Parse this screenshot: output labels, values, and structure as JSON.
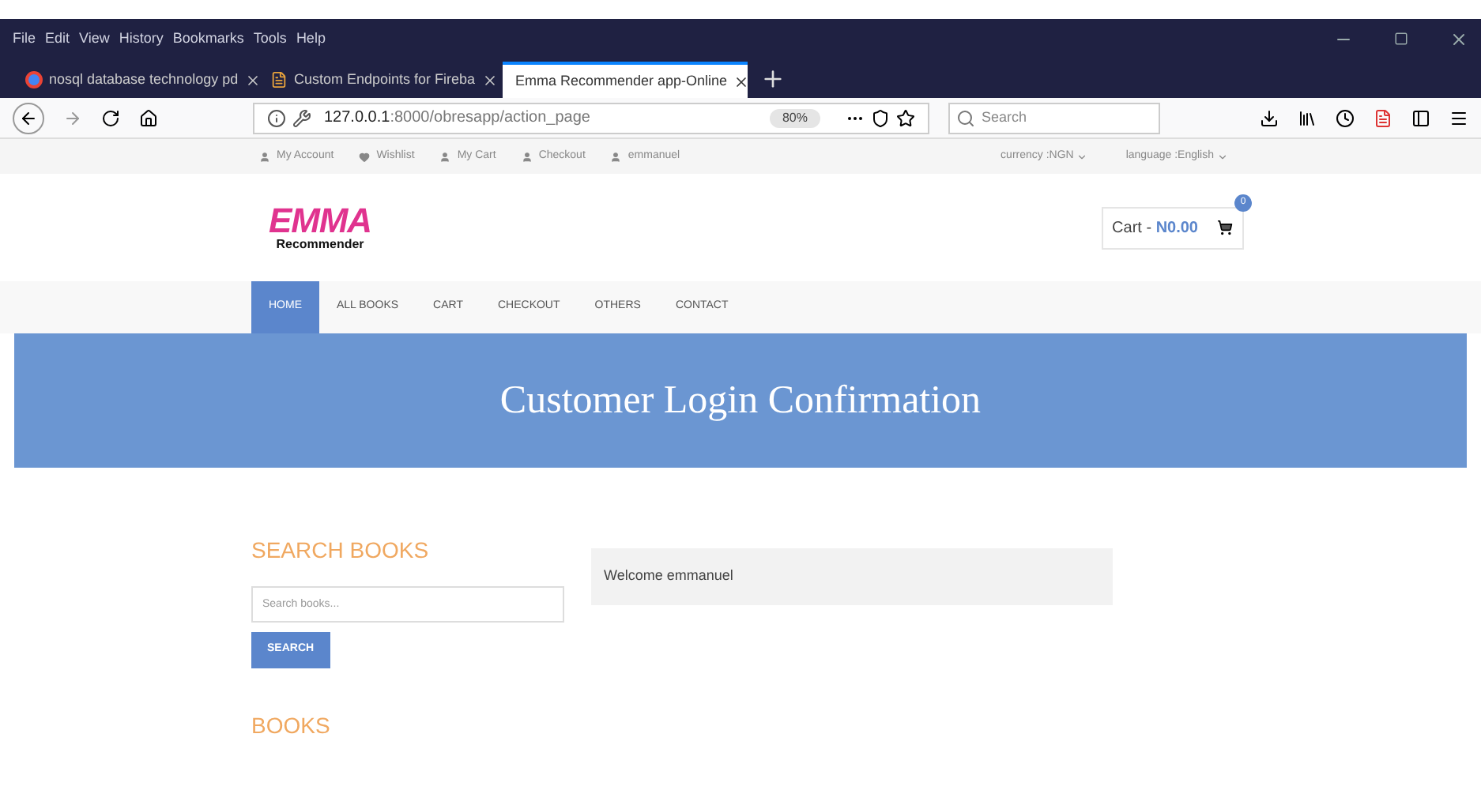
{
  "menu_bar": [
    "File",
    "Edit",
    "View",
    "History",
    "Bookmarks",
    "Tools",
    "Help"
  ],
  "tabs": [
    {
      "title": "nosql database technology pd",
      "selected": false
    },
    {
      "title": "Custom Endpoints for Fireba",
      "selected": false
    },
    {
      "title": "Emma Recommender app-Online",
      "selected": true
    }
  ],
  "url_bar": {
    "host": "127.0.0.1",
    "path": ":8000/obresapp/action_page",
    "zoom": "80%"
  },
  "search_field": {
    "placeholder": "Search"
  },
  "top_links": [
    "My Account",
    "Wishlist",
    "My Cart",
    "Checkout",
    "emmanuel"
  ],
  "top_selectors": [
    "currency :NGN",
    "language :English"
  ],
  "logo": {
    "title": "EMMA",
    "subtitle": "Recommender"
  },
  "cart": {
    "label": "Cart - ",
    "amount": "N0.00",
    "count": "0"
  },
  "nav": [
    {
      "label": "HOME",
      "selected": true
    },
    {
      "label": "ALL BOOKS",
      "selected": false
    },
    {
      "label": "CART",
      "selected": false
    },
    {
      "label": "CHECKOUT",
      "selected": false
    },
    {
      "label": "OTHERS",
      "selected": false
    },
    {
      "label": "CONTACT",
      "selected": false
    }
  ],
  "banner_title": "Customer Login Confirmation",
  "sidebar": {
    "search_heading": "SEARCH BOOKS",
    "search_placeholder": "Search books...",
    "search_button": "SEARCH",
    "books_heading": "BOOKS"
  },
  "welcome_message": "Welcome emmanuel"
}
